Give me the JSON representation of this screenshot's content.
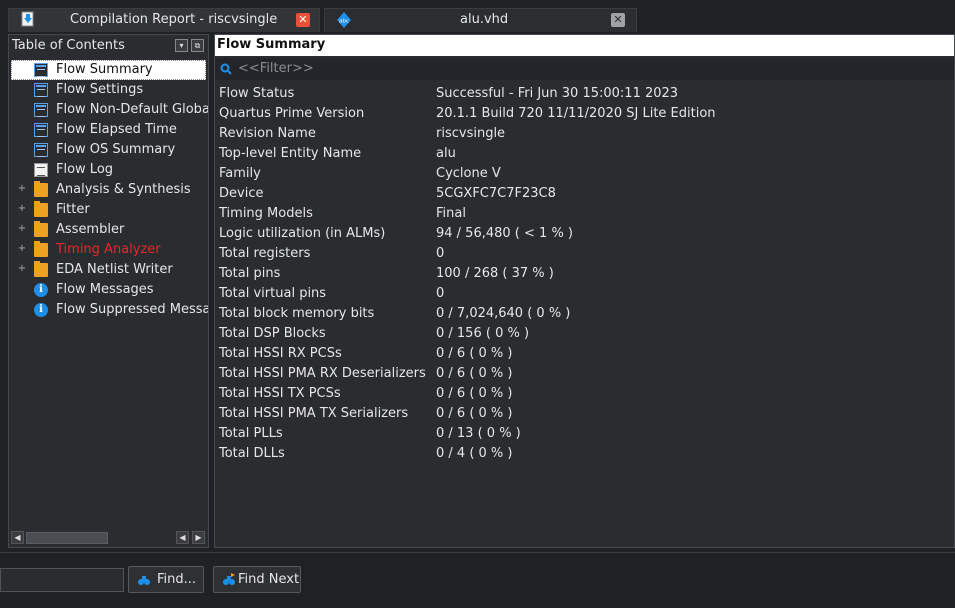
{
  "tabs": [
    {
      "title": "Compilation Report - riscvsingle",
      "active": true,
      "icon": "compilation-report-icon"
    },
    {
      "title": "alu.vhd",
      "active": false,
      "icon": "vhdl-file-icon"
    }
  ],
  "toc": {
    "title": "Table of Contents",
    "items": [
      {
        "label": "Flow Summary",
        "icon": "table-icon",
        "expandable": false,
        "selected": true
      },
      {
        "label": "Flow Settings",
        "icon": "table-icon",
        "expandable": false
      },
      {
        "label": "Flow Non-Default Global",
        "icon": "table-icon",
        "expandable": false
      },
      {
        "label": "Flow Elapsed Time",
        "icon": "table-icon",
        "expandable": false
      },
      {
        "label": "Flow OS Summary",
        "icon": "table-icon",
        "expandable": false
      },
      {
        "label": "Flow Log",
        "icon": "document-icon",
        "expandable": false
      },
      {
        "label": "Analysis & Synthesis",
        "icon": "folder-icon",
        "expandable": true
      },
      {
        "label": "Fitter",
        "icon": "folder-icon",
        "expandable": true
      },
      {
        "label": "Assembler",
        "icon": "folder-icon",
        "expandable": true
      },
      {
        "label": "Timing Analyzer",
        "icon": "folder-icon",
        "expandable": true,
        "color": "#e8262b"
      },
      {
        "label": "EDA Netlist Writer",
        "icon": "folder-icon",
        "expandable": true
      },
      {
        "label": "Flow Messages",
        "icon": "info-icon",
        "expandable": false
      },
      {
        "label": "Flow Suppressed Messag",
        "icon": "info-icon",
        "expandable": false
      }
    ]
  },
  "main": {
    "title": "Flow Summary",
    "filter_placeholder": "<<Filter>>",
    "rows": [
      {
        "key": "Flow Status",
        "value": "Successful - Fri Jun 30 15:00:11 2023"
      },
      {
        "key": "Quartus Prime Version",
        "value": "20.1.1 Build 720 11/11/2020 SJ Lite Edition"
      },
      {
        "key": "Revision Name",
        "value": "riscvsingle"
      },
      {
        "key": "Top-level Entity Name",
        "value": "alu"
      },
      {
        "key": "Family",
        "value": "Cyclone V"
      },
      {
        "key": "Device",
        "value": "5CGXFC7C7F23C8"
      },
      {
        "key": "Timing Models",
        "value": "Final"
      },
      {
        "key": "Logic utilization (in ALMs)",
        "value": "94 / 56,480 ( < 1 % )"
      },
      {
        "key": "Total registers",
        "value": "0"
      },
      {
        "key": "Total pins",
        "value": "100 / 268 ( 37 % )"
      },
      {
        "key": "Total virtual pins",
        "value": "0"
      },
      {
        "key": "Total block memory bits",
        "value": "0 / 7,024,640 ( 0 % )"
      },
      {
        "key": "Total DSP Blocks",
        "value": "0 / 156 ( 0 % )"
      },
      {
        "key": "Total HSSI RX PCSs",
        "value": "0 / 6 ( 0 % )"
      },
      {
        "key": "Total HSSI PMA RX Deserializers",
        "value": "0 / 6 ( 0 % )"
      },
      {
        "key": "Total HSSI TX PCSs",
        "value": "0 / 6 ( 0 % )"
      },
      {
        "key": "Total HSSI PMA TX Serializers",
        "value": "0 / 6 ( 0 % )"
      },
      {
        "key": "Total PLLs",
        "value": "0 / 13 ( 0 % )"
      },
      {
        "key": "Total DLLs",
        "value": "0 / 4 ( 0 % )"
      }
    ]
  },
  "bottom": {
    "find_label": "Find...",
    "find_next_label": "Find Next",
    "find_value": ""
  },
  "colors": {
    "accent": "#1e8fe8",
    "folder": "#f0a020",
    "error_red": "#e8262b",
    "close_red": "#e8503a"
  }
}
